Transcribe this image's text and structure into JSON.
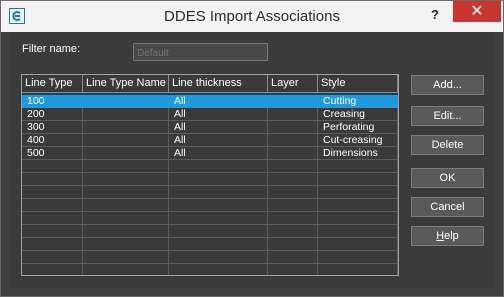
{
  "window": {
    "title": "DDES Import Associations",
    "help_label": "?",
    "close_label": "✕"
  },
  "filter": {
    "label": "Filter name:",
    "placeholder": "Default"
  },
  "table": {
    "columns": [
      "Line Type",
      "Line Type Name",
      "Line thickness",
      "Layer",
      "Style"
    ],
    "rows": [
      {
        "line_type": "100",
        "name": "",
        "thickness": "All",
        "layer": "",
        "style": "Cutting"
      },
      {
        "line_type": "200",
        "name": "",
        "thickness": "All",
        "layer": "",
        "style": "Creasing"
      },
      {
        "line_type": "300",
        "name": "",
        "thickness": "All",
        "layer": "",
        "style": "Perforating"
      },
      {
        "line_type": "400",
        "name": "",
        "thickness": "All",
        "layer": "",
        "style": "Cut-creasing"
      },
      {
        "line_type": "500",
        "name": "",
        "thickness": "All",
        "layer": "",
        "style": "Dimensions"
      }
    ],
    "selected_row": 0
  },
  "buttons": {
    "add": "Add...",
    "edit": "Edit...",
    "delete": "Delete",
    "ok": "OK",
    "cancel": "Cancel",
    "help": "Help"
  },
  "colors": {
    "selection": "#1e9be0",
    "close": "#c7372f",
    "background": "#3b3b3b"
  }
}
